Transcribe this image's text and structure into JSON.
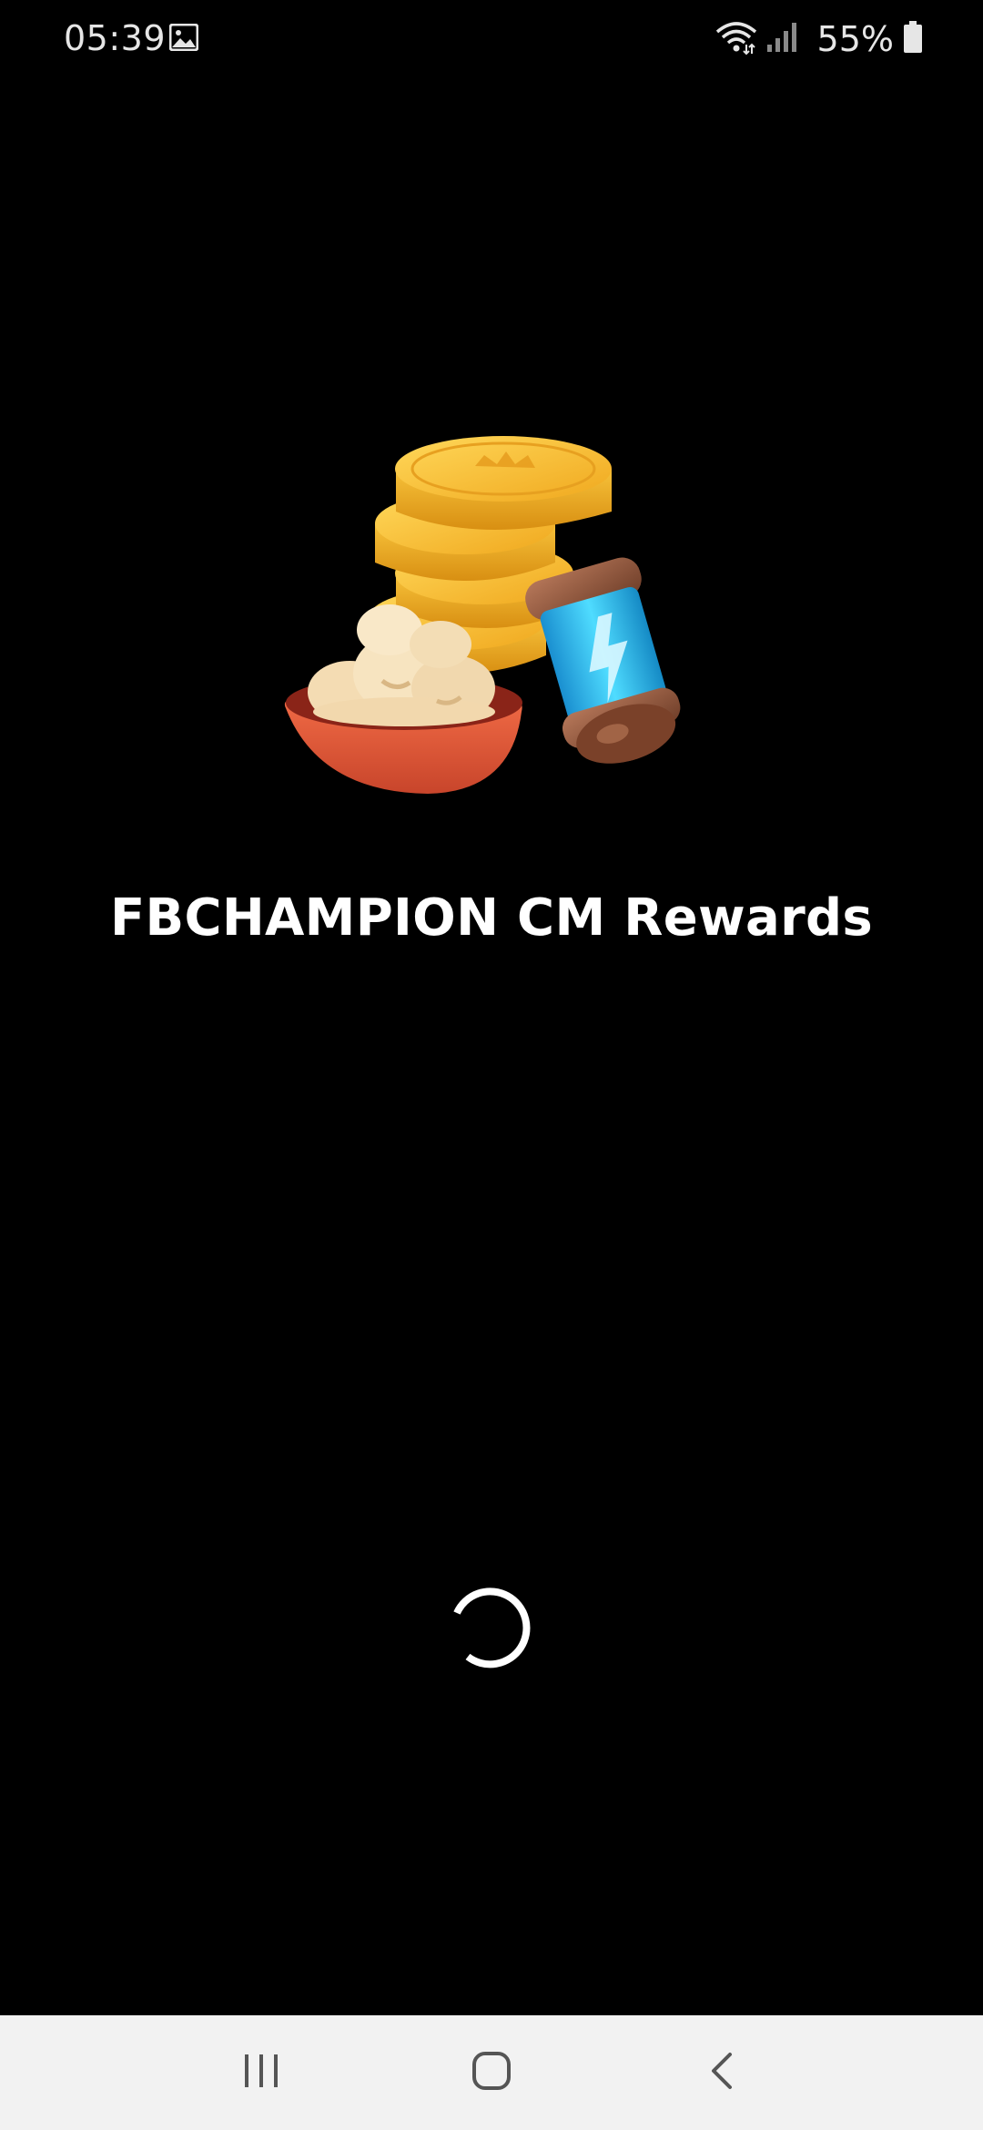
{
  "status_bar": {
    "time": "05:39",
    "gallery_icon": "image-icon",
    "wifi_icon": "wifi-icon",
    "signal_icon": "cell-signal-icon",
    "battery_percent": "55%",
    "battery_icon": "battery-icon"
  },
  "splash": {
    "art_icon": "coins-and-spin-capsule-illustration",
    "title": "FBCHAMPION CM Rewards",
    "loading_icon": "loading-spinner-icon"
  },
  "nav_bar": {
    "recents_icon": "recent-apps-icon",
    "home_icon": "home-icon",
    "back_icon": "back-icon"
  },
  "colors": {
    "background": "#000000",
    "title": "#ffffff",
    "nav_background": "#f2f2f2",
    "nav_icons": "#555555",
    "coin": "#f2b52a",
    "capsule": "#2ec3f0",
    "bowl": "#e2583a"
  }
}
